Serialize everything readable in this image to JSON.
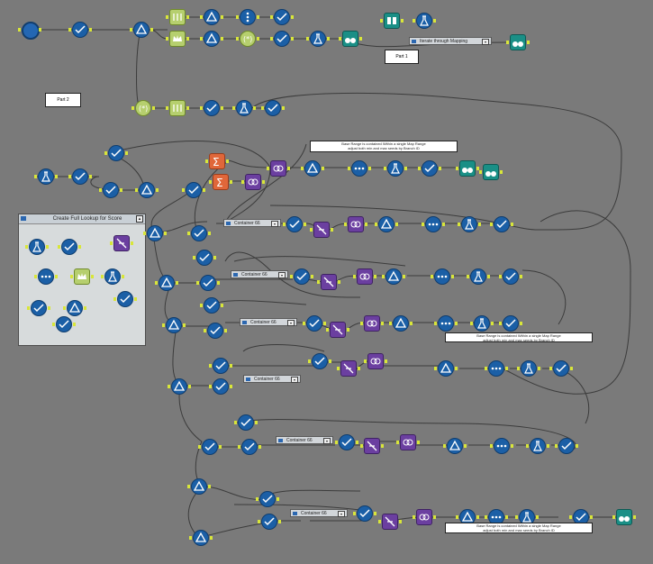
{
  "workflow": {
    "labels": {
      "part1": "Part 1",
      "part2": "Part 2"
    },
    "panels": {
      "fuzzy_lookup": "Create Full Lookup for Score"
    },
    "containers": {
      "iterate": "Iterate through Mapping",
      "c1": "Container 66",
      "c2": "Container 66",
      "c3": "Container 66",
      "c4": "Container 66",
      "c5": "Container 66",
      "c6": "Container 66"
    },
    "comments": {
      "note1_line1": "Base Range is contained Within a single Map Range",
      "note1_line2": "adjust both min and max seeds by Branch ID",
      "note2_line1": "Base Range is contained Within a single Map Range",
      "note2_line2": "adjust both min and max seeds by Branch ID",
      "note3_line1": "Base Range is contained Within a single Map Range",
      "note3_line2": "adjust both min and max seeds by Branch ID"
    },
    "colors": {
      "canvas": "#7a7a7a",
      "tool_blue": "#1b5fa6",
      "tool_teal": "#1a8f86",
      "tool_purple": "#6b3fa0",
      "tool_orange": "#e0673a",
      "tool_lime": "#b6cf6e",
      "anchor": "#d8e63a",
      "wire": "#3c3c3c"
    }
  }
}
